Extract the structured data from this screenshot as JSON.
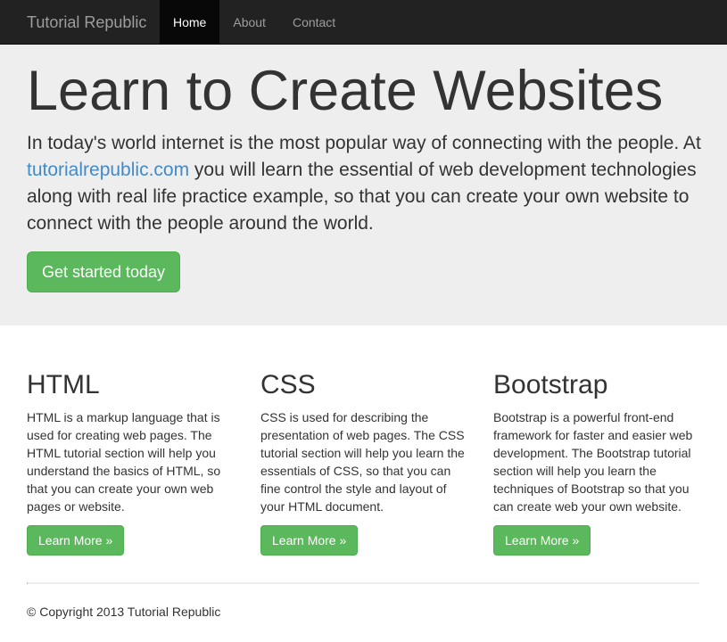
{
  "navbar": {
    "brand": "Tutorial Republic",
    "items": [
      {
        "label": "Home",
        "active": true
      },
      {
        "label": "About",
        "active": false
      },
      {
        "label": "Contact",
        "active": false
      }
    ]
  },
  "hero": {
    "title": "Learn to Create Websites",
    "text_before_link": "In today's world internet is the most popular way of connecting with the people. At ",
    "link_text": "tutorialrepublic.com",
    "text_after_link": " you will learn the essential of web development technologies along with real life practice example, so that you can create your own website to connect with the people around the world.",
    "button_label": "Get started today"
  },
  "columns": [
    {
      "heading": "HTML",
      "text": "HTML is a markup language that is used for creating web pages. The HTML tutorial section will help you understand the basics of HTML, so that you can create your own web pages or website.",
      "button_label": "Learn More »"
    },
    {
      "heading": "CSS",
      "text": "CSS is used for describing the presentation of web pages. The CSS tutorial section will help you learn the essentials of CSS, so that you can fine control the style and layout of your HTML document.",
      "button_label": "Learn More »"
    },
    {
      "heading": "Bootstrap",
      "text": "Bootstrap is a powerful front-end framework for faster and easier web development. The Bootstrap tutorial section will help you learn the techniques of Bootstrap so that you can create web your own website.",
      "button_label": "Learn More »"
    }
  ],
  "footer": {
    "copyright": "© Copyright 2013 Tutorial Republic"
  },
  "colors": {
    "navbar_bg": "#222222",
    "jumbotron_bg": "#eeeeee",
    "button_green": "#5cb85c",
    "link_blue": "#428bca"
  }
}
